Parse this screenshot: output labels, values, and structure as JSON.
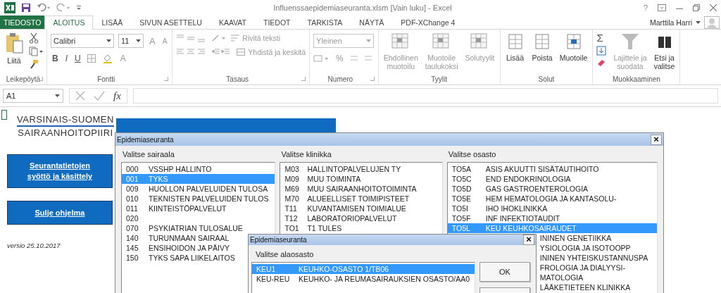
{
  "window": {
    "title": "Influenssaepidemiaseuranta.xlsm  [Vain luku] - Excel",
    "help": "?"
  },
  "ribbon_tabs": [
    {
      "label": "TIEDOSTO",
      "kind": "file",
      "selected": false
    },
    {
      "label": "ALOITUS",
      "kind": "tab",
      "selected": true
    },
    {
      "label": "LISÄÄ",
      "kind": "tab",
      "selected": false
    },
    {
      "label": "SIVUN ASETTELU",
      "kind": "tab",
      "selected": false
    },
    {
      "label": "KAAVAT",
      "kind": "tab",
      "selected": false
    },
    {
      "label": "TIEDOT",
      "kind": "tab",
      "selected": false
    },
    {
      "label": "TARKISTA",
      "kind": "tab",
      "selected": false
    },
    {
      "label": "NÄYTÄ",
      "kind": "tab",
      "selected": false
    },
    {
      "label": "PDF-XChange 4",
      "kind": "tab",
      "selected": false
    }
  ],
  "user": {
    "name": "Marttila Harri"
  },
  "clipboard": {
    "label": "Leikepöytä",
    "paste": "Liitä"
  },
  "font": {
    "label": "Fontti",
    "family": "Calibri",
    "size": "11",
    "grow": "A",
    "shrink": "A",
    "bold": "B",
    "italic": "I",
    "underline": "U",
    "font_color_letter": "A"
  },
  "alignment": {
    "label": "Tasaus",
    "wrap": "Rivitä teksti",
    "merge": "Yhdistä ja keskitä"
  },
  "number": {
    "label": "Numero",
    "format": "Yleinen",
    "percent": "%"
  },
  "styles": {
    "label": "Tyylit",
    "buttons": [
      {
        "lines": [
          "Ehdollinen",
          "muotoilu"
        ],
        "disabled": true
      },
      {
        "lines": [
          "Muotoile",
          "taulukoksi"
        ],
        "disabled": true
      },
      {
        "lines": [
          "Solutyylit"
        ],
        "disabled": true
      }
    ]
  },
  "cells": {
    "label": "Solut",
    "buttons": [
      {
        "lines": [
          "Lisää"
        ],
        "disabled": false
      },
      {
        "lines": [
          "Poista"
        ],
        "disabled": false
      },
      {
        "lines": [
          "Muotoile"
        ],
        "disabled": false
      }
    ]
  },
  "editing": {
    "label": "Muokkaaminen",
    "sum": "Σ",
    "buttons": [
      {
        "lines": [
          "Lajittele ja",
          "suodata"
        ],
        "disabled": true
      },
      {
        "lines": [
          "Etsi ja",
          "valitse"
        ],
        "disabled": false
      }
    ]
  },
  "formula_bar": {
    "name_box": "A1",
    "fx": "fx"
  },
  "sheet": {
    "logo_lines": [
      "VARSINAIS-SUOMEN",
      "SAIRAANHOITOPIIRI"
    ],
    "buttons": [
      {
        "lines": [
          "Seurantatietojen",
          "syöttö ja käsittely"
        ]
      },
      {
        "lines": [
          "Sulje ohjelma"
        ]
      }
    ],
    "version": "versio 25.10.2017"
  },
  "dialog": {
    "title": "Epidemiaseuranta",
    "close": "×",
    "columns": [
      {
        "label": "Valitse sairaala",
        "items": [
          {
            "kind": "row",
            "code": "000",
            "name": "VSSHP HALLINTO",
            "selected": false
          },
          {
            "kind": "row",
            "code": "001",
            "name": "TYKS",
            "selected": true
          },
          {
            "kind": "row",
            "code": "009",
            "name": "HUOLLON PALVELUIDEN TULOSA",
            "selected": false
          },
          {
            "kind": "row",
            "code": "010",
            "name": "TEKNISTEN PALVELUIDEN TULOS",
            "selected": false
          },
          {
            "kind": "row",
            "code": "011",
            "name": "KIINTEISTÖPALVELUT",
            "selected": false
          },
          {
            "kind": "row",
            "code": "020",
            "selected": false
          },
          {
            "kind": "row",
            "code": "070",
            "name": "PSYKIATRIAN TULOSALUE",
            "selected": false
          },
          {
            "kind": "row",
            "code": "140",
            "name": "TURUNMAAN SAIRAAL",
            "selected": false
          },
          {
            "kind": "row",
            "code": "145",
            "name": "ENSIHOIDON JA PÄIVY",
            "selected": false
          },
          {
            "kind": "row",
            "code": "150",
            "name": "TYKS SAPA LIIKELAITOS",
            "selected": false
          }
        ]
      },
      {
        "label": "Valitse klinikka",
        "items": [
          {
            "kind": "row",
            "code": "M03",
            "name": "HALLINTOPALVELUJEN TY",
            "selected": false
          },
          {
            "kind": "row",
            "code": "M09",
            "name": "MUU TOIMINTA",
            "selected": false
          },
          {
            "kind": "row",
            "code": "M69",
            "name": "MUU SAIRAANHOITOTOIMINTA",
            "selected": false
          },
          {
            "kind": "row",
            "code": "M70",
            "name": "ALUEELLISET TOIMIPISTEET",
            "selected": false
          },
          {
            "kind": "row",
            "code": "T11",
            "name": "KUVANTAMISEN TOIMIALUE",
            "selected": false
          },
          {
            "kind": "row",
            "code": "T12",
            "name": "LABORATORIOPALVELUT",
            "selected": false
          },
          {
            "kind": "row",
            "code": "TO1",
            "name": "T1 TULES",
            "selected": false
          }
        ]
      },
      {
        "label": "Valitse osasto",
        "items": [
          {
            "kind": "row",
            "code": "TO5A",
            "name": "ASIS AKUUTTI SISÄTAUTIHOITO",
            "selected": false
          },
          {
            "kind": "row",
            "code": "TO5C",
            "name": "END ENDOKRINOLOGIA",
            "selected": false
          },
          {
            "kind": "row",
            "code": "TO5D",
            "name": "GAS GASTROENTEROLOGIA",
            "selected": false
          },
          {
            "kind": "row",
            "code": "TO5E",
            "name": "HEM HEMATOLOGIA JA KANTASOLU-",
            "selected": false
          },
          {
            "kind": "row",
            "code": "TO5I",
            "name": "IHO IHOKLINIKKA",
            "selected": false
          },
          {
            "kind": "row",
            "code": "TO5F",
            "name": "INF INFEKTIOTAUDIT",
            "selected": false
          },
          {
            "kind": "row",
            "code": "TO5L",
            "name": "KEU KEUHKOSAIRAUDET",
            "selected": true
          },
          {
            "kind": "covered",
            "name": "ININEN GENETIIKKA",
            "selected": false
          },
          {
            "kind": "covered",
            "name": "YSIOLOGIA JA ISOTOOPP",
            "selected": false
          },
          {
            "kind": "covered",
            "name": "ININEN YHTEISKUSTANNUSPA",
            "selected": false
          },
          {
            "kind": "covered",
            "name": "FROLOGIA JA DIALYYSI-",
            "selected": false
          },
          {
            "kind": "covered",
            "name": "MATOLOGIA",
            "selected": false
          },
          {
            "kind": "covered",
            "name": "LÄÄKETIETEEN KLINIKKA",
            "selected": false
          }
        ]
      }
    ]
  },
  "subdialog": {
    "title": "Epidemiaseuranta",
    "close": "×",
    "label": "Valitse alaosasto",
    "items": [
      {
        "code": "KEU1",
        "name": "KEUHKO-OSASTO 1/TB06",
        "selected": true
      },
      {
        "code": "KEU-REU",
        "name": "KEUHKO- JA REUMASAIRAUKSIEN OSASTO/AA0",
        "selected": false
      }
    ],
    "ok": "OK"
  }
}
